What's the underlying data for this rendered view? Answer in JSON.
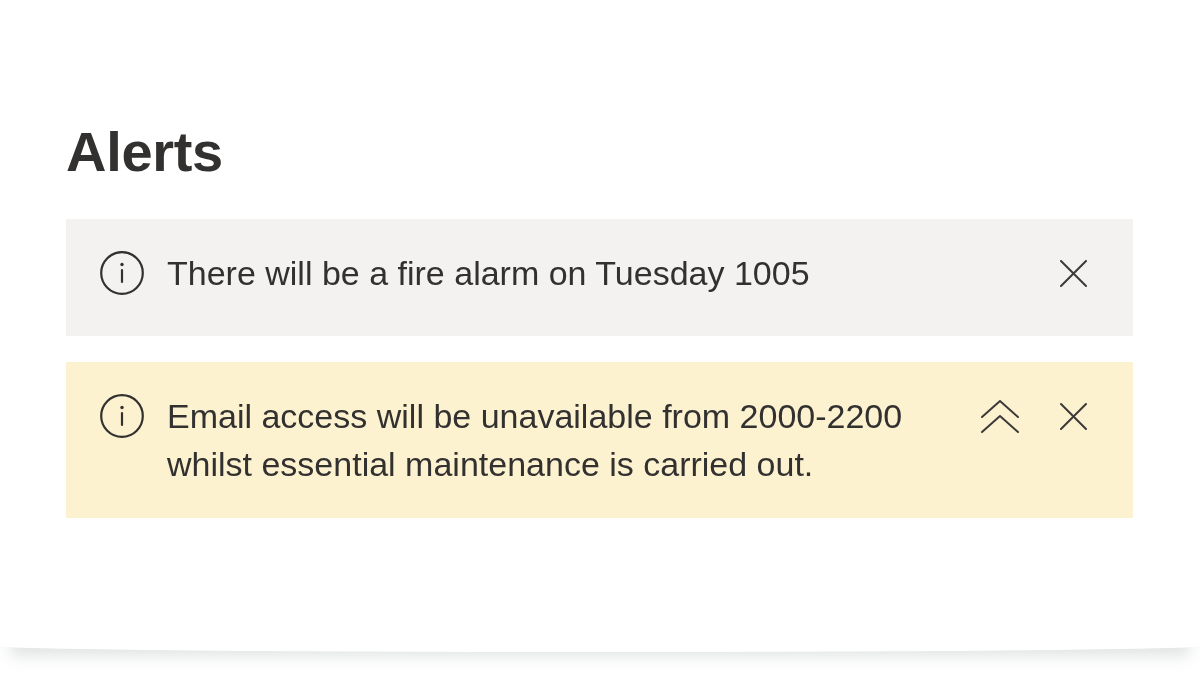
{
  "page": {
    "title": "Alerts"
  },
  "alerts": [
    {
      "kind": "info",
      "message": "There will be a fire alarm on Tuesday 1005",
      "actions": [
        {
          "kind": "dismiss"
        }
      ]
    },
    {
      "kind": "warning",
      "message": "Email access will be unavailable from 2000-2200 whilst essential maintenance is carried out.",
      "actions": [
        {
          "kind": "collapse"
        },
        {
          "kind": "dismiss"
        }
      ]
    }
  ]
}
